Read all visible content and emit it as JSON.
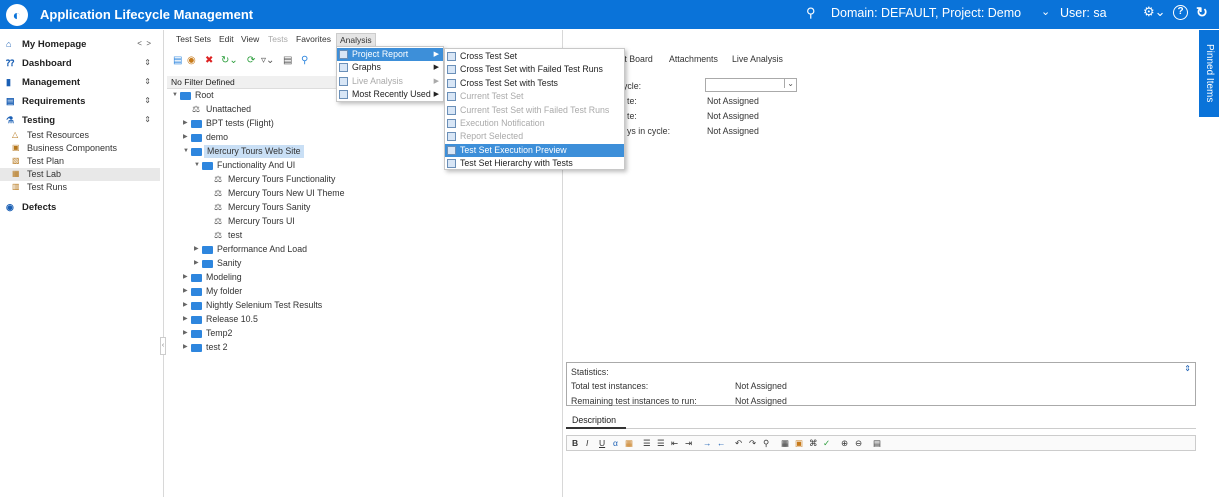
{
  "header": {
    "app_title": "Application Lifecycle Management",
    "domain_project": "Domain: DEFAULT, Project: Demo",
    "user": "User: sa",
    "help_label": "?"
  },
  "sidebar": {
    "homepage": "My Homepage",
    "dashboard": "Dashboard",
    "management": "Management",
    "requirements": "Requirements",
    "testing": "Testing",
    "testing_items": [
      "Test Resources",
      "Business Components",
      "Test Plan",
      "Test Lab",
      "Test Runs"
    ],
    "defects": "Defects"
  },
  "toolbar_menu": [
    "Test Sets",
    "Edit",
    "View",
    "Tests",
    "Favorites",
    "Analysis"
  ],
  "filter_label": "No Filter Defined",
  "tree": [
    {
      "label": "Root",
      "level": 0,
      "type": "folder",
      "open": true
    },
    {
      "label": "Unattached",
      "level": 1,
      "type": "test"
    },
    {
      "label": "BPT tests (Flight)",
      "level": 1,
      "type": "folder"
    },
    {
      "label": "demo",
      "level": 1,
      "type": "folder"
    },
    {
      "label": "Mercury Tours Web Site",
      "level": 1,
      "type": "folder",
      "open": true,
      "selected": true
    },
    {
      "label": "Functionality And UI",
      "level": 2,
      "type": "folder",
      "open": true
    },
    {
      "label": "Mercury Tours Functionality",
      "level": 3,
      "type": "test"
    },
    {
      "label": "Mercury Tours New UI Theme",
      "level": 3,
      "type": "test"
    },
    {
      "label": "Mercury Tours Sanity",
      "level": 3,
      "type": "test"
    },
    {
      "label": "Mercury Tours UI",
      "level": 3,
      "type": "test"
    },
    {
      "label": "test",
      "level": 3,
      "type": "test"
    },
    {
      "label": "Performance And Load",
      "level": 2,
      "type": "folder"
    },
    {
      "label": "Sanity",
      "level": 2,
      "type": "folder"
    },
    {
      "label": "Modeling",
      "level": 1,
      "type": "folder"
    },
    {
      "label": "My folder",
      "level": 1,
      "type": "folder"
    },
    {
      "label": "Nightly Selenium Test Results",
      "level": 1,
      "type": "folder"
    },
    {
      "label": "Release 10.5",
      "level": 1,
      "type": "folder"
    },
    {
      "label": "Temp2",
      "level": 1,
      "type": "folder"
    },
    {
      "label": "test 2",
      "level": 1,
      "type": "folder"
    }
  ],
  "right_tabs": [
    "st Board",
    "Attachments",
    "Live Analysis"
  ],
  "details": {
    "cycle_label": "ycle:",
    "row1_label": "te:",
    "row1_value": "Not Assigned",
    "row2_label": "te:",
    "row2_value": "Not Assigned",
    "row3_label": "ys in cycle:",
    "row3_value": "Not Assigned"
  },
  "pinned_items": "Pinned Items",
  "statistics": {
    "title": "Statistics:",
    "total_label": "Total test instances:",
    "total_value": "Not Assigned",
    "remaining_label": "Remaining test instances to run:",
    "remaining_value": "Not Assigned"
  },
  "description_tab": "Description",
  "editor_toolbar": {
    "bold": "B",
    "italic": "I",
    "underline": "U"
  },
  "analysis_menu": [
    {
      "label": "Project Report",
      "submenu": true,
      "selected": true
    },
    {
      "label": "Graphs",
      "submenu": true
    },
    {
      "label": "Live Analysis",
      "submenu": true,
      "disabled": true
    },
    {
      "label": "Most Recently Used",
      "submenu": true
    }
  ],
  "project_report_menu": [
    {
      "label": "Cross Test Set"
    },
    {
      "label": "Cross Test Set with Failed Test Runs"
    },
    {
      "label": "Cross Test Set with Tests"
    },
    {
      "label": "Current Test Set",
      "disabled": true
    },
    {
      "label": "Current Test Set with Failed Test Runs",
      "disabled": true
    },
    {
      "label": "Execution Notification",
      "disabled": true
    },
    {
      "label": "Report Selected",
      "disabled": true
    },
    {
      "label": "Test Set Execution Preview",
      "selected": true
    },
    {
      "label": "Test Set Hierarchy with Tests"
    }
  ],
  "colors": {
    "brand": "#0a73d9",
    "selection": "#3d8fd9",
    "tree_highlight": "#c9dff5"
  }
}
